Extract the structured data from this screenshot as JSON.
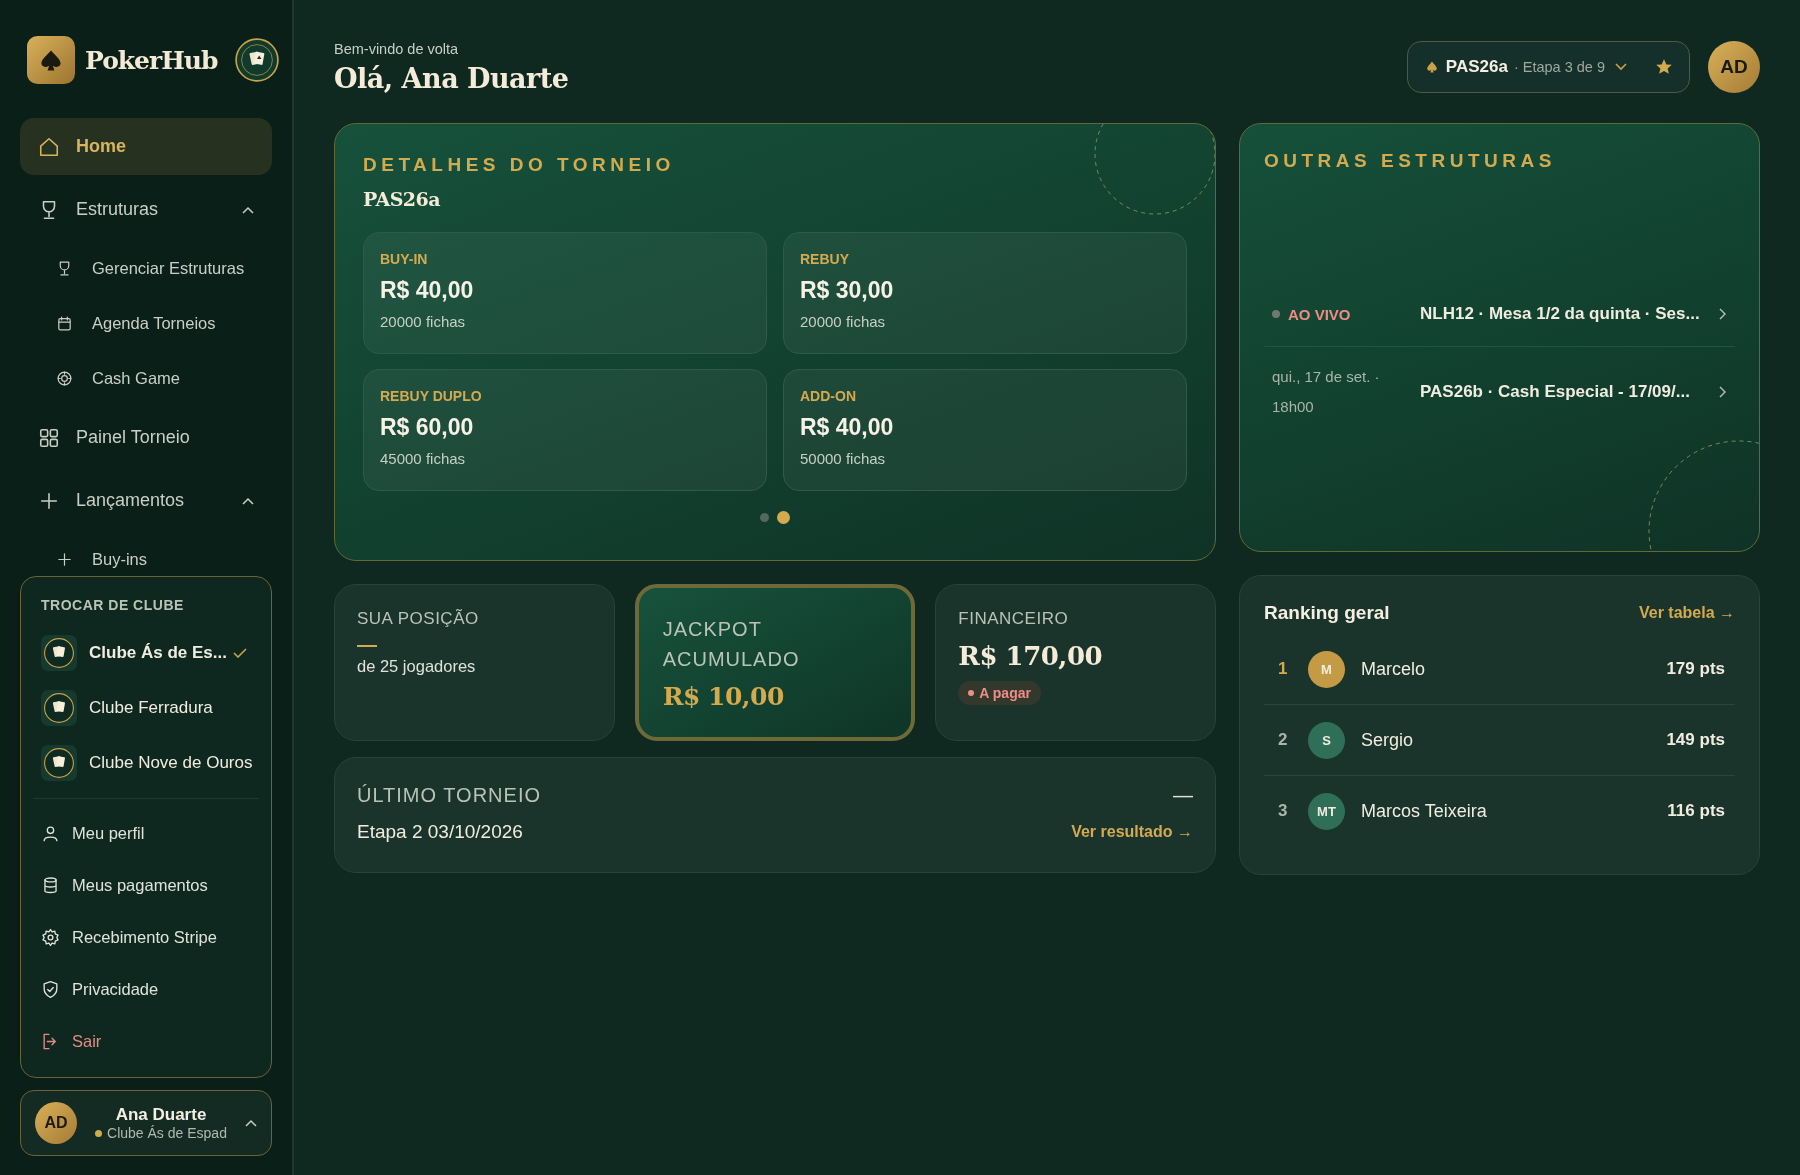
{
  "brand": {
    "name": "PokerHub"
  },
  "nav": [
    {
      "label": "Home",
      "kind": "main",
      "selected": true
    },
    {
      "label": "Estruturas",
      "kind": "group",
      "selected": false,
      "expanded": true
    },
    {
      "label": "Gerenciar Estruturas",
      "kind": "sub",
      "selected": false
    },
    {
      "label": "Agenda Torneios",
      "kind": "sub",
      "selected": false
    },
    {
      "label": "Cash Game",
      "kind": "sub",
      "selected": false
    },
    {
      "label": "Painel Torneio",
      "kind": "main",
      "selected": false
    },
    {
      "label": "Lançamentos",
      "kind": "group",
      "selected": false,
      "expanded": true
    },
    {
      "label": "Buy-ins",
      "kind": "sub",
      "selected": false
    }
  ],
  "club_menu": {
    "title": "TROCAR DE CLUBE",
    "clubs": [
      {
        "name": "Clube Ás de Es...",
        "selected": true
      },
      {
        "name": "Clube Ferradura",
        "selected": false
      },
      {
        "name": "Clube Nove de Ouros",
        "selected": false
      }
    ],
    "items": [
      {
        "label": "Meu perfil",
        "kind": "normal"
      },
      {
        "label": "Meus pagamentos",
        "kind": "normal"
      },
      {
        "label": "Recebimento Stripe",
        "kind": "normal"
      },
      {
        "label": "Privacidade",
        "kind": "normal"
      },
      {
        "label": "Sair",
        "kind": "danger"
      }
    ]
  },
  "user_card": {
    "initials": "AD",
    "name": "Ana Duarte",
    "club": "Clube Ás de Espad",
    "expanded": true
  },
  "header": {
    "greeting": "Bem-vindo de volta",
    "title": "Olá, Ana Duarte",
    "tournament": "PAS26a",
    "stage": "· Etapa 3 de 9",
    "avatar": "AD"
  },
  "details": {
    "title": "DETALHES DO TORNEIO",
    "name": "PAS26a",
    "tiles": [
      {
        "label": "BUY-IN",
        "value": "R$ 40,00",
        "chips": "20000 fichas"
      },
      {
        "label": "REBUY",
        "value": "R$ 30,00",
        "chips": "20000 fichas"
      },
      {
        "label": "REBUY DUPLO",
        "value": "R$ 60,00",
        "chips": "45000 fichas"
      },
      {
        "label": "ADD-ON",
        "value": "R$ 40,00",
        "chips": "50000 fichas"
      }
    ],
    "pages": [
      {
        "selected": false
      },
      {
        "selected": true
      }
    ]
  },
  "position": {
    "title": "SUA POSIÇÃO",
    "value": "—",
    "caption": "de 25 jogadores"
  },
  "jackpot": {
    "title": "JACKPOT ACUMULADO",
    "value": "R$ 10,00"
  },
  "finance": {
    "title": "FINANCEIRO",
    "value": "R$ 170,00",
    "status": "A pagar"
  },
  "last": {
    "title": "ÚLTIMO TORNEIO",
    "value": "Etapa 2 03/10/2026",
    "mark": "—",
    "link": "Ver resultado →"
  },
  "others": {
    "title": "OUTRAS ESTRUTURAS",
    "rows": [
      {
        "kind": "live",
        "when": "AO VIVO",
        "name": "NLH12 · Mesa 1/2 da quinta · Ses..."
      },
      {
        "kind": "scheduled",
        "when": "qui., 17 de set. · 18h00",
        "name": "PAS26b · Cash Especial - 17/09/..."
      }
    ]
  },
  "ranking": {
    "title": "Ranking geral",
    "link": "Ver tabela →",
    "rows": [
      {
        "rank": "1",
        "initials": "M",
        "name": "Marcelo",
        "points": "179 pts",
        "color": "#c49a45"
      },
      {
        "rank": "2",
        "initials": "S",
        "name": "Sergio",
        "points": "149 pts",
        "color": "#2f6e57"
      },
      {
        "rank": "3",
        "initials": "MT",
        "name": "Marcos Teixeira",
        "points": "116 pts",
        "color": "#2f6e57"
      }
    ]
  }
}
